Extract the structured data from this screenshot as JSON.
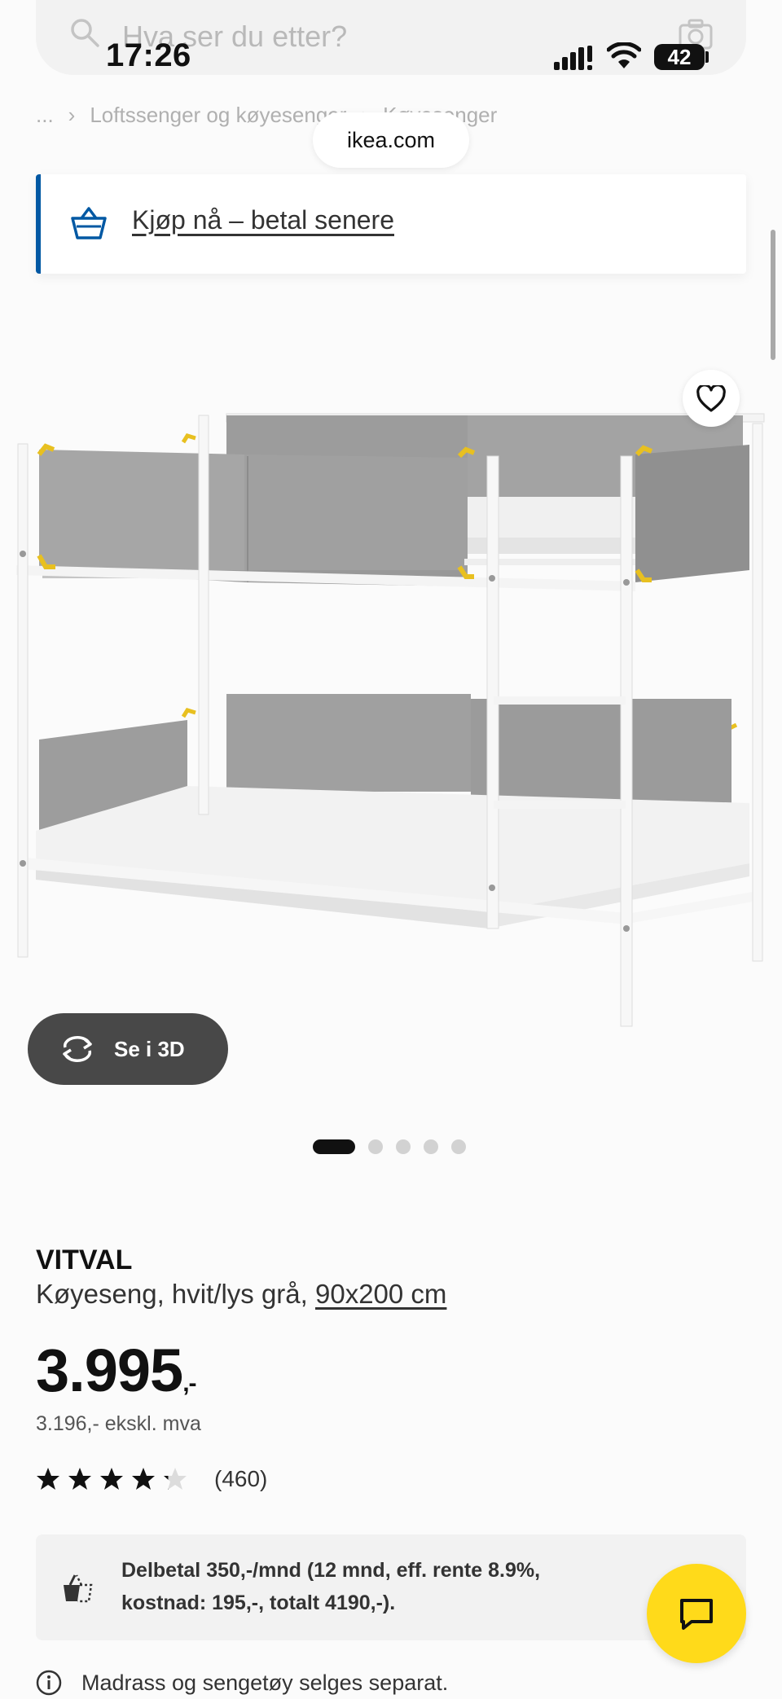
{
  "header": {
    "search_placeholder": "Hva ser du etter?",
    "url": "ikea.com"
  },
  "status_bar": {
    "time": "17:26",
    "battery": "42"
  },
  "breadcrumb": {
    "ellipsis": "...",
    "separator": "›",
    "item": "Loftssenger og køyesenger",
    "item2": "Køyesenger"
  },
  "bnpl": {
    "link": "Kjøp nå – betal senere"
  },
  "gallery": {
    "view_3d_label": "Se i 3D",
    "dot_count": 5,
    "active_dot": 0
  },
  "product": {
    "name": "VITVAL",
    "description": "Køyeseng, hvit/lys grå, ",
    "size": "90x200 cm",
    "price": "3.995",
    "price_suffix": ",-",
    "price_ex_vat": "3.196,- ekskl. mva",
    "rating": 4.2,
    "rating_max": 5,
    "review_count": "(460)"
  },
  "installment": {
    "text": "Delbetal 350,-/mnd (12 mnd, eff. rente 8.9%, kostnad: 195,-, totalt 4190,-)."
  },
  "note": {
    "text": "Madrass og sengetøy selges separat."
  },
  "colors": {
    "ikea_blue": "#0058a3",
    "ikea_yellow": "#ffda1a",
    "frame_white": "#f4f4f4",
    "fabric_grey": "#9c9c9c",
    "accent_yellow": "#e8c020"
  },
  "icons": [
    "search-icon",
    "camera-icon",
    "signal-icon",
    "wifi-icon",
    "basket-icon",
    "heart-icon",
    "rotate-icon",
    "star-icon",
    "installment-icon",
    "chat-icon",
    "info-icon"
  ]
}
